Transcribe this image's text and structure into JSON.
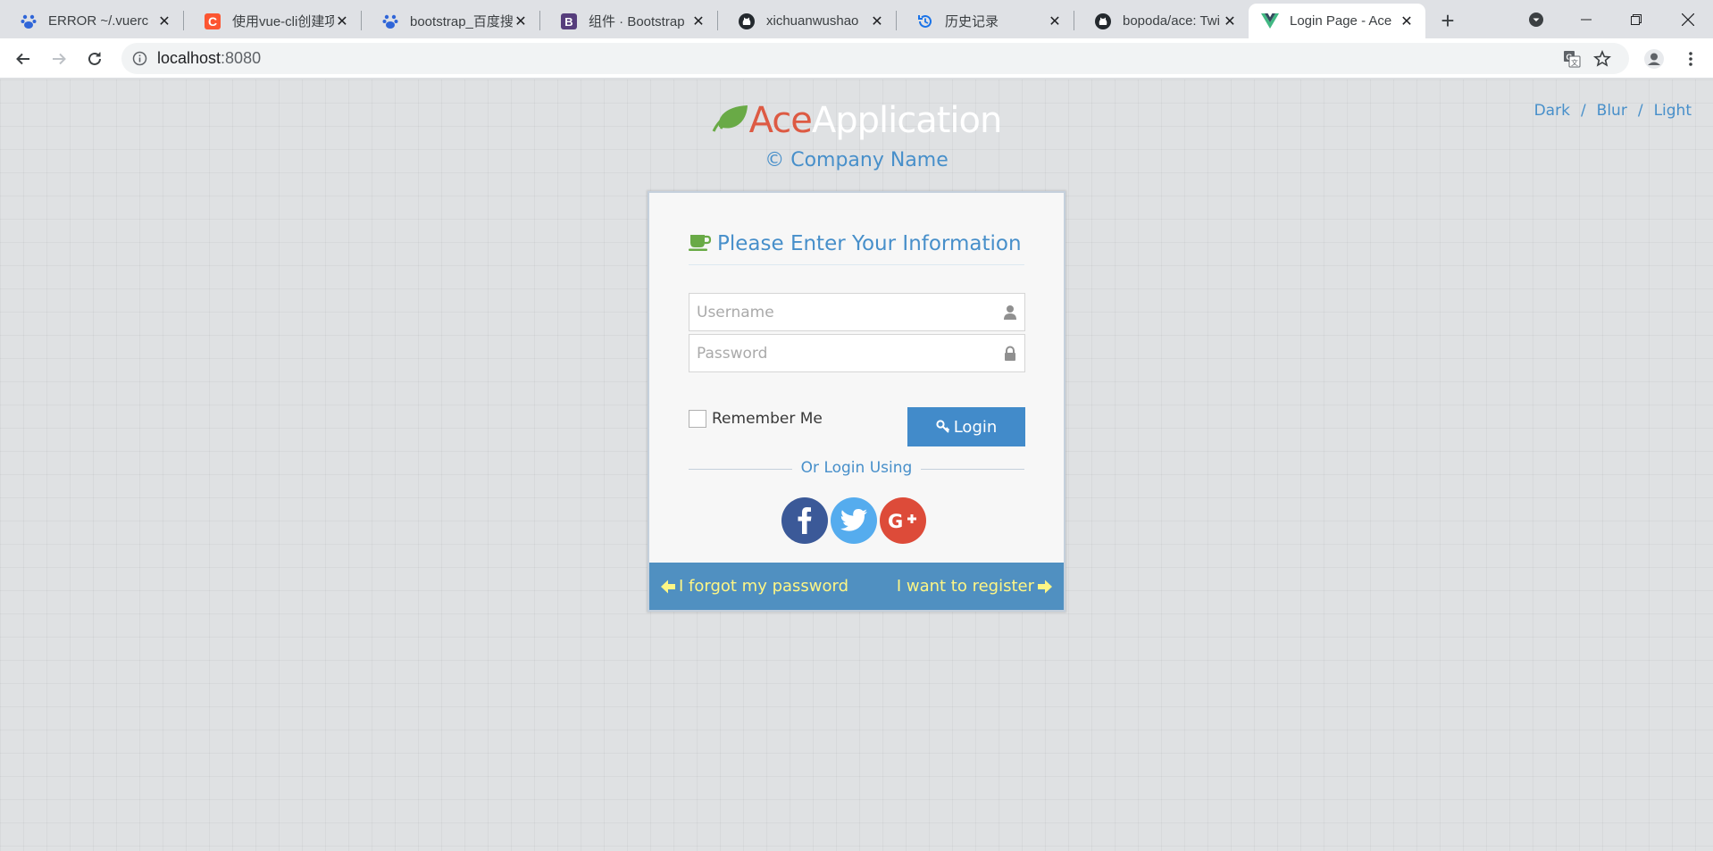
{
  "browser": {
    "tabs": [
      {
        "title": "ERROR ~/.vuerc",
        "favicon": "baidu-paw-icon"
      },
      {
        "title": "使用vue-cli创建项",
        "favicon": "csdn-c-icon"
      },
      {
        "title": "bootstrap_百度搜",
        "favicon": "baidu-paw-icon"
      },
      {
        "title": "组件 · Bootstrap",
        "favicon": "bootstrap-b-icon"
      },
      {
        "title": "xichuanwushao",
        "favicon": "github-icon"
      },
      {
        "title": "历史记录",
        "favicon": "history-icon"
      },
      {
        "title": "bopoda/ace: Twi",
        "favicon": "github-icon"
      },
      {
        "title": "Login Page - Ace",
        "favicon": "vue-icon",
        "active": true
      }
    ],
    "url_host": "localhost",
    "url_port": ":8080"
  },
  "brand": {
    "ace": "Ace",
    "application": "Application",
    "company": "© Company Name",
    "leaf_color": "#69aa46"
  },
  "theme_links": [
    "Dark",
    "Blur",
    "Light"
  ],
  "theme_separator": "/",
  "login": {
    "heading": "Please Enter Your Information",
    "username_placeholder": "Username",
    "password_placeholder": "Password",
    "remember_label": "Remember Me",
    "login_button": "Login",
    "or_text": "Or Login Using",
    "social": [
      {
        "name": "facebook",
        "glyph": "f",
        "color": "#3b5998"
      },
      {
        "name": "twitter",
        "glyph": "twitter-bird",
        "color": "#55acee"
      },
      {
        "name": "google-plus",
        "glyph": "G+",
        "color": "#dd4b39"
      }
    ],
    "forgot_link": "I forgot my password",
    "register_link": "I want to register"
  },
  "colors": {
    "accent_blue": "#478fca",
    "button_blue": "#428bca",
    "footer_bg": "#5090c1",
    "footer_link": "#fef685",
    "ace_red": "#dd5a43"
  }
}
